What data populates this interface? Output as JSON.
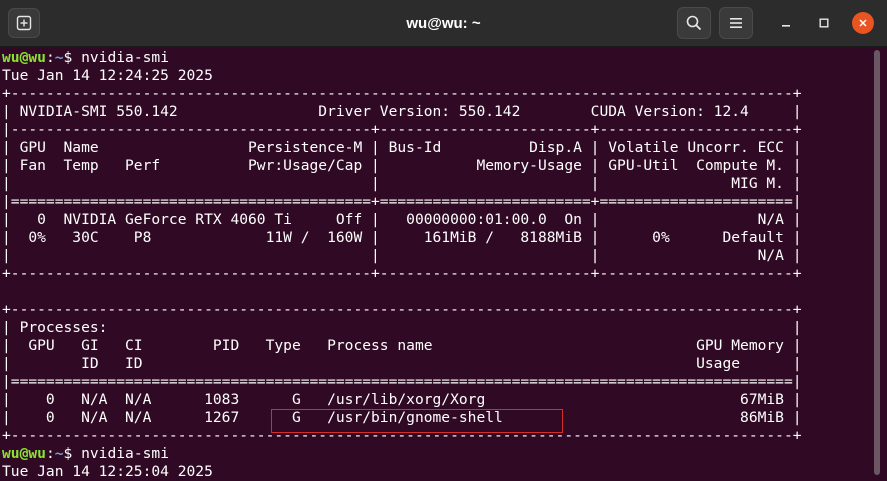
{
  "window": {
    "title": "wu@wu: ~",
    "icons": {
      "new_tab": "new-tab-icon",
      "search": "search-icon",
      "menu": "hamburger-menu-icon",
      "minimize": "minimize-icon",
      "maximize": "maximize-icon",
      "close": "close-icon"
    }
  },
  "prompt": {
    "user_host": "wu@wu",
    "path": "~",
    "symbol": "$"
  },
  "colors": {
    "background": "#300a24",
    "prompt_user": "#8ae234",
    "prompt_path": "#729fcf",
    "close_button": "#e95420",
    "highlight_box": "#d62c2c"
  },
  "commands": [
    {
      "command": " nvidia-smi"
    },
    {
      "command": " nvidia-smi"
    }
  ],
  "output": {
    "lines": [
      "Tue Jan 14 12:24:25 2025",
      "+-----------------------------------------------------------------------------------------+",
      "| NVIDIA-SMI 550.142                Driver Version: 550.142        CUDA Version: 12.4     |",
      "|-----------------------------------------+------------------------+----------------------+",
      "| GPU  Name                 Persistence-M | Bus-Id          Disp.A | Volatile Uncorr. ECC |",
      "| Fan  Temp   Perf          Pwr:Usage/Cap |           Memory-Usage | GPU-Util  Compute M. |",
      "|                                         |                        |               MIG M. |",
      "|=========================================+========================+======================|",
      "|   0  NVIDIA GeForce RTX 4060 Ti     Off |   00000000:01:00.0  On |                  N/A |",
      "|  0%   30C    P8             11W /  160W |     161MiB /   8188MiB |      0%      Default |",
      "|                                         |                        |                  N/A |",
      "+-----------------------------------------+------------------------+----------------------+",
      "",
      "+-----------------------------------------------------------------------------------------+",
      "| Processes:                                                                              |",
      "|  GPU   GI   CI        PID   Type   Process name                              GPU Memory |",
      "|        ID   ID                                                               Usage      |",
      "|=========================================================================================|",
      "|    0   N/A  N/A      1083      G   /usr/lib/xorg/Xorg                             67MiB |",
      "|    0   N/A  N/A      1267      G   /usr/bin/gnome-shell                           86MiB |",
      "+-----------------------------------------------------------------------------------------+"
    ],
    "last_line": "Tue Jan 14 12:25:04 2025"
  }
}
